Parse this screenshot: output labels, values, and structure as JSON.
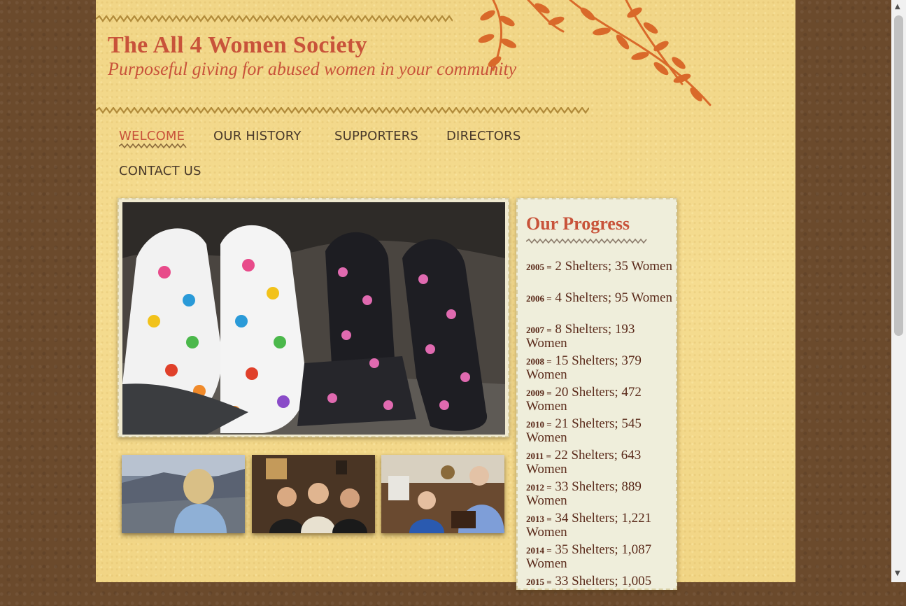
{
  "site": {
    "title": "The All 4 Women Society",
    "tagline": "Purposeful giving for abused women in your community"
  },
  "nav": {
    "items": [
      {
        "label": "WELCOME",
        "active": true
      },
      {
        "label": "OUR HISTORY",
        "active": false
      },
      {
        "label": "SUPPORTERS",
        "active": false
      },
      {
        "label": "DIRECTORS",
        "active": false
      },
      {
        "label": "CONTACT US",
        "active": false
      }
    ]
  },
  "progress": {
    "heading": "Our Progress",
    "items": [
      {
        "year": "2005 =",
        "text": "2 Shelters; 35 Women"
      },
      {
        "year": "2006 =",
        "text": "4 Shelters; 95 Women"
      },
      {
        "year": "2007 =",
        "text": "8 Shelters; 193 Women"
      },
      {
        "year": "2008 =",
        "text": "15 Shelters; 379 Women"
      },
      {
        "year": "2009 =",
        "text": "20 Shelters; 472 Women"
      },
      {
        "year": "2010 =",
        "text": "21 Shelters; 545 Women"
      },
      {
        "year": "2011 =",
        "text": "22 Shelters; 643 Women"
      },
      {
        "year": "2012 =",
        "text": "33 Shelters; 889 Women"
      },
      {
        "year": "2013 =",
        "text": "34 Shelters; 1,221 Women"
      },
      {
        "year": "2014 =",
        "text": "35 Shelters; 1,087 Women"
      },
      {
        "year": "2015 =",
        "text": "33 Shelters; 1,005"
      }
    ]
  },
  "colors": {
    "accent": "#c8533a",
    "paper": "#f3d98a",
    "nav_text": "#4a3a2a"
  },
  "icons": {
    "scroll_up": "▲",
    "scroll_down": "▼"
  }
}
